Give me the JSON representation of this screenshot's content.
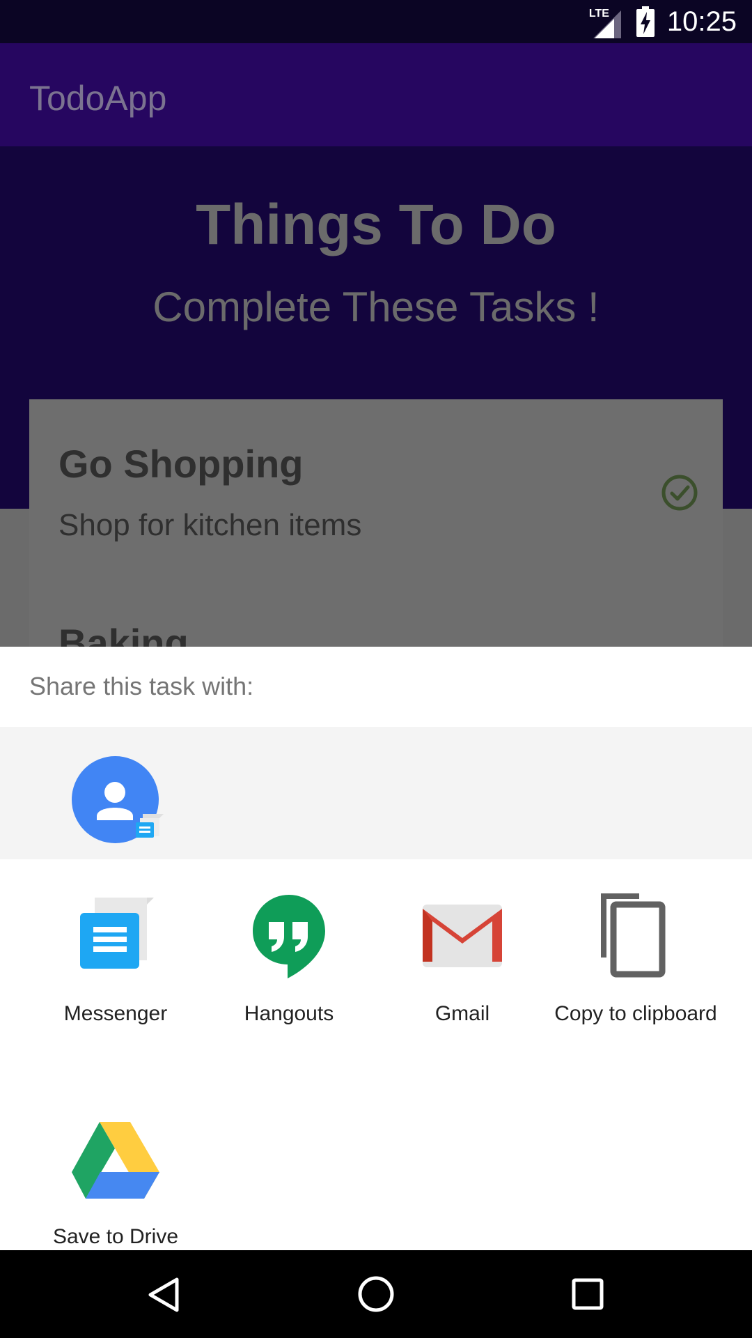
{
  "status_bar": {
    "network": "LTE",
    "time": "10:25"
  },
  "app_bar": {
    "title": "TodoApp"
  },
  "header": {
    "title": "Things To Do",
    "subtitle": "Complete These Tasks !"
  },
  "tasks": [
    {
      "title": "Go Shopping",
      "description": "Shop for kitchen items",
      "done": true
    },
    {
      "title": "Baking"
    }
  ],
  "share_sheet": {
    "title": "Share this task with:",
    "apps": [
      {
        "label": "Messenger",
        "icon": "messenger-icon"
      },
      {
        "label": "Hangouts",
        "icon": "hangouts-icon"
      },
      {
        "label": "Gmail",
        "icon": "gmail-icon"
      },
      {
        "label": "Copy to clipboard",
        "icon": "copy-icon"
      },
      {
        "label": "Save to Drive",
        "icon": "drive-icon"
      }
    ]
  },
  "nav_bar": {
    "buttons": [
      "back",
      "home",
      "recents"
    ]
  },
  "colors": {
    "app_bar": "#260660",
    "header": "#13053d",
    "accent_blue": "#4185f4"
  }
}
